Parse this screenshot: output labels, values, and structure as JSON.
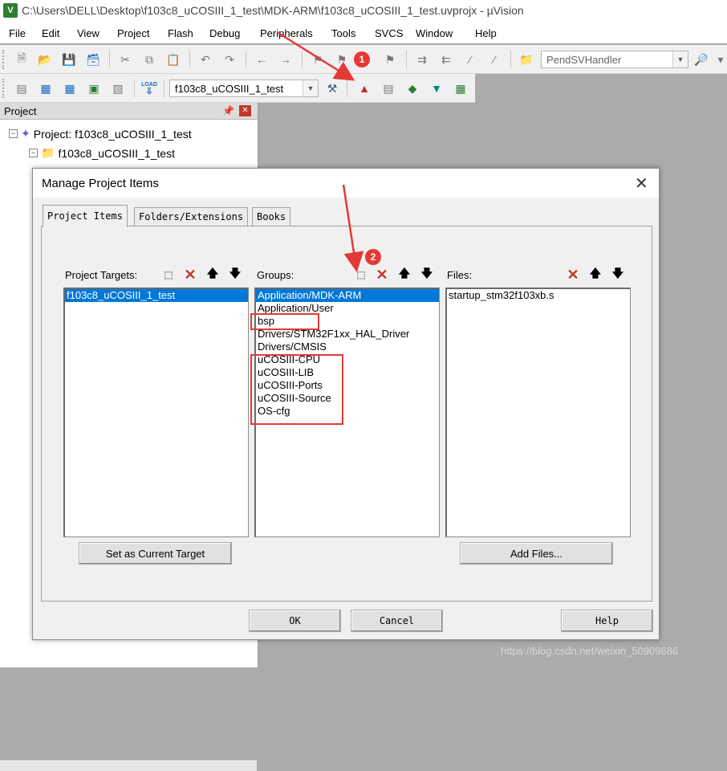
{
  "window": {
    "title": "C:\\Users\\DELL\\Desktop\\f103c8_uCOSIII_1_test\\MDK-ARM\\f103c8_uCOSIII_1_test.uvprojx - µVision",
    "app_icon_letter": "V"
  },
  "menu": [
    "File",
    "Edit",
    "View",
    "Project",
    "Flash",
    "Debug",
    "Peripherals",
    "Tools",
    "SVCS",
    "Window",
    "Help"
  ],
  "toolbar": {
    "find_combo_value": "PendSVHandler",
    "target_combo_value": "f103c8_uCOSIII_1_test",
    "load_label": "LOAD"
  },
  "project_panel": {
    "title": "Project",
    "tree": [
      {
        "label": "Project: f103c8_uCOSIII_1_test"
      },
      {
        "label": "f103c8_uCOSIII_1_test"
      }
    ]
  },
  "dialog": {
    "title": "Manage Project Items",
    "tabs": [
      "Project Items",
      "Folders/Extensions",
      "Books"
    ],
    "targets_label": "Project Targets:",
    "groups_label": "Groups:",
    "files_label": "Files:",
    "targets": [
      "f103c8_uCOSIII_1_test"
    ],
    "groups": [
      "Application/MDK-ARM",
      "Application/User",
      "bsp",
      "Drivers/STM32F1xx_HAL_Driver",
      "Drivers/CMSIS",
      "uCOSIII-CPU",
      "uCOSIII-LIB",
      "uCOSIII-Ports",
      "uCOSIII-Source",
      "OS-cfg"
    ],
    "files": [
      "startup_stm32f103xb.s"
    ],
    "set_current_target": "Set as Current Target",
    "add_files": "Add Files...",
    "ok": "OK",
    "cancel": "Cancel",
    "help": "Help"
  },
  "annotations": {
    "badge_1": "1",
    "badge_2": "2",
    "color": "#e53935"
  },
  "watermark": "https://blog.csdn.net/weixin_50909686"
}
